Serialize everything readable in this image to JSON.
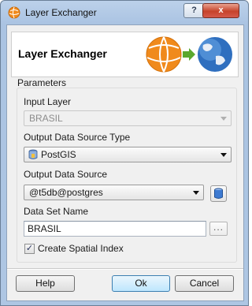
{
  "window": {
    "title": "Layer Exchanger",
    "help_glyph": "?",
    "close_glyph": "x"
  },
  "banner": {
    "title": "Layer Exchanger",
    "colors": {
      "orange": "#f08a1c",
      "green": "#5aa82e",
      "globe": "#2f6fbf"
    }
  },
  "parameters": {
    "group_label": "Parameters",
    "input_layer": {
      "label": "Input Layer",
      "value": "BRASIL",
      "enabled": false
    },
    "output_type": {
      "label": "Output Data Source Type",
      "value": "PostGIS"
    },
    "output_source": {
      "label": "Output Data Source",
      "value": "@t5db@postgres"
    },
    "dataset_name": {
      "label": "Data Set Name",
      "value": "BRASIL",
      "browse_label": "..."
    },
    "spatial_index": {
      "label": "Create Spatial Index",
      "checked": true,
      "check_glyph": "✓"
    }
  },
  "buttons": {
    "help": "Help",
    "ok": "Ok",
    "cancel": "Cancel"
  }
}
